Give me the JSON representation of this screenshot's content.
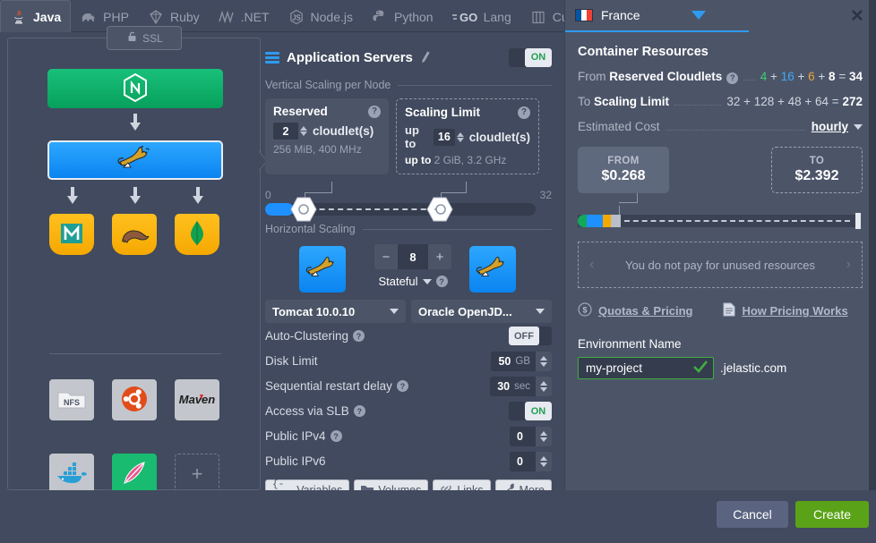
{
  "tabs": [
    {
      "label": "Java",
      "icon": "java-icon",
      "active": true
    },
    {
      "label": "PHP",
      "icon": "php-elephant-icon",
      "active": false
    },
    {
      "label": "Ruby",
      "icon": "ruby-gem-icon",
      "active": false
    },
    {
      "label": ".NET",
      "icon": "dotnet-icon",
      "active": false
    },
    {
      "label": "Node.js",
      "icon": "nodejs-icon",
      "active": false
    },
    {
      "label": "Python",
      "icon": "python-icon",
      "active": false
    },
    {
      "label": "Lang",
      "icon": "go-lang-icon",
      "active": false
    },
    {
      "label": "Custom",
      "icon": "custom-stack-icon",
      "active": false
    }
  ],
  "topology": {
    "ssl_label": "SSL",
    "nodes": [
      {
        "name": "nginx-balancer-node",
        "icon": "nginx-icon"
      },
      {
        "name": "tomcat-app-server-node",
        "icon": "tomcat-icon",
        "selected": true
      }
    ],
    "databases": [
      {
        "name": "mariadb-node",
        "icon": "mariadb-icon"
      },
      {
        "name": "postgres-node",
        "icon": "postgres-elephant-seal-icon"
      },
      {
        "name": "mongodb-node",
        "icon": "mongodb-leaf-icon"
      }
    ],
    "extras": [
      {
        "name": "nfs-storage-node",
        "icon": "nfs-icon",
        "label": "NFS"
      },
      {
        "name": "ubuntu-vps-node",
        "icon": "ubuntu-icon"
      },
      {
        "name": "maven-build-node",
        "icon": "maven-icon",
        "label": "Maven"
      },
      {
        "name": "docker-engine-node",
        "icon": "docker-whale-icon"
      },
      {
        "name": "apache-node",
        "icon": "apache-feather-icon"
      },
      {
        "name": "add-node",
        "icon": "plus-icon",
        "label": "+"
      }
    ]
  },
  "middle": {
    "title": "Application Servers",
    "edit_icon": "pencil-icon",
    "menu_icon": "hamburger-icon",
    "power_toggle": "ON",
    "vertical_section": "Vertical Scaling per Node",
    "reserved": {
      "title": "Reserved",
      "value": "2",
      "unit": "cloudlet(s)",
      "sub": "256 MiB, 400 MHz"
    },
    "scaling_limit": {
      "title": "Scaling Limit",
      "prefix": "up to",
      "value": "16",
      "unit": "cloudlet(s)",
      "sub_prefix": "up to",
      "sub": "2 GiB, 3.2 GHz"
    },
    "slider": {
      "min_label": "0",
      "max_label": "32",
      "min": 0,
      "max": 32,
      "reserved_value": 2,
      "limit_value": 16
    },
    "horizontal_section": "Horizontal Scaling",
    "node_count": "8",
    "minus_label": "−",
    "plus_label": "+",
    "stateful_label": "Stateful",
    "engine_dropdown": "Tomcat 10.0.10",
    "jdk_dropdown": "Oracle OpenJD...",
    "options": [
      {
        "label": "Auto-Clustering",
        "help": true,
        "type": "toggle",
        "value": "OFF"
      },
      {
        "label": "Disk Limit",
        "help": false,
        "type": "unit",
        "value": "50",
        "unit": "GB"
      },
      {
        "label": "Sequential restart delay",
        "help": true,
        "type": "unit",
        "value": "30",
        "unit": "sec"
      },
      {
        "label": "Access via SLB",
        "help": true,
        "type": "toggle",
        "value": "ON"
      },
      {
        "label": "Public IPv4",
        "help": true,
        "type": "number",
        "value": "0"
      },
      {
        "label": "Public IPv6",
        "help": false,
        "type": "number",
        "value": "0"
      }
    ],
    "footer_buttons": [
      {
        "label": "Variables",
        "icon": "braces-icon"
      },
      {
        "label": "Volumes",
        "icon": "volumes-icon"
      },
      {
        "label": "Links",
        "icon": "link-icon"
      },
      {
        "label": "More",
        "icon": "wrench-icon"
      }
    ]
  },
  "right": {
    "country": "France",
    "country_flag": "france-flag-icon",
    "close_icon": "close-icon",
    "heading": "Container Resources",
    "from_label_prefix": "From",
    "from_label": "Reserved Cloudlets",
    "from_parts": [
      "4",
      "16",
      "6",
      "8"
    ],
    "from_total": "34",
    "to_label_prefix": "To",
    "to_label": "Scaling Limit",
    "to_expr": "32 + 128 + 48 + 64 =",
    "to_total": "272",
    "estimated_cost_label": "Estimated Cost",
    "period": "hourly",
    "from_cap": "FROM",
    "from_price": "$0.268",
    "to_cap": "TO",
    "to_price": "$2.392",
    "unused_note": "You do not pay for unused resources",
    "prev_icon": "chevron-left-icon",
    "next_icon": "chevron-right-icon",
    "quotas_link": "Quotas & Pricing",
    "quotas_icon": "dollar-circle-icon",
    "pricing_link": "How Pricing Works",
    "pricing_icon": "document-icon",
    "env_name_label": "Environment Name",
    "env_name_value": "my-project",
    "env_valid_icon": "check-icon",
    "env_suffix": ".jelastic.com"
  },
  "footer": {
    "cancel": "Cancel",
    "create": "Create"
  },
  "colors": {
    "accent_blue": "#2e9bf0",
    "green": "#18bb6f",
    "create_green": "#5aa318",
    "panel_bg": "#414a5e",
    "right_bg": "#4c5568",
    "orange": "#f5a800"
  }
}
